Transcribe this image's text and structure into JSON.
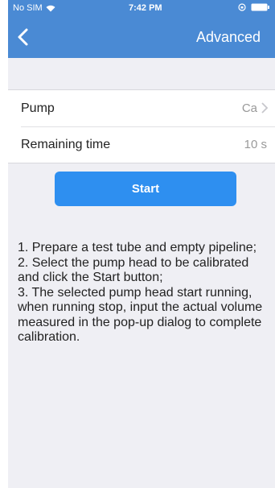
{
  "status_bar": {
    "carrier": "No SIM",
    "time": "7:42 PM"
  },
  "nav": {
    "back_icon": "chevron-left-icon",
    "title": "Advanced"
  },
  "settings": {
    "rows": [
      {
        "label": "Pump",
        "value": "Ca"
      },
      {
        "label": "Remaining time",
        "value": "10 s"
      }
    ]
  },
  "start_button": {
    "label": "Start"
  },
  "instructions": [
    "1. Prepare a test tube and empty pipeline;",
    "2. Select the pump head to be calibrated and click the Start button;",
    "3. The selected pump head start running, when running stop, input the actual volume measured in the pop-up dialog to complete calibration."
  ],
  "colors": {
    "header": "#4a8ad4",
    "button": "#2e8ff0",
    "background": "#efeff4"
  }
}
